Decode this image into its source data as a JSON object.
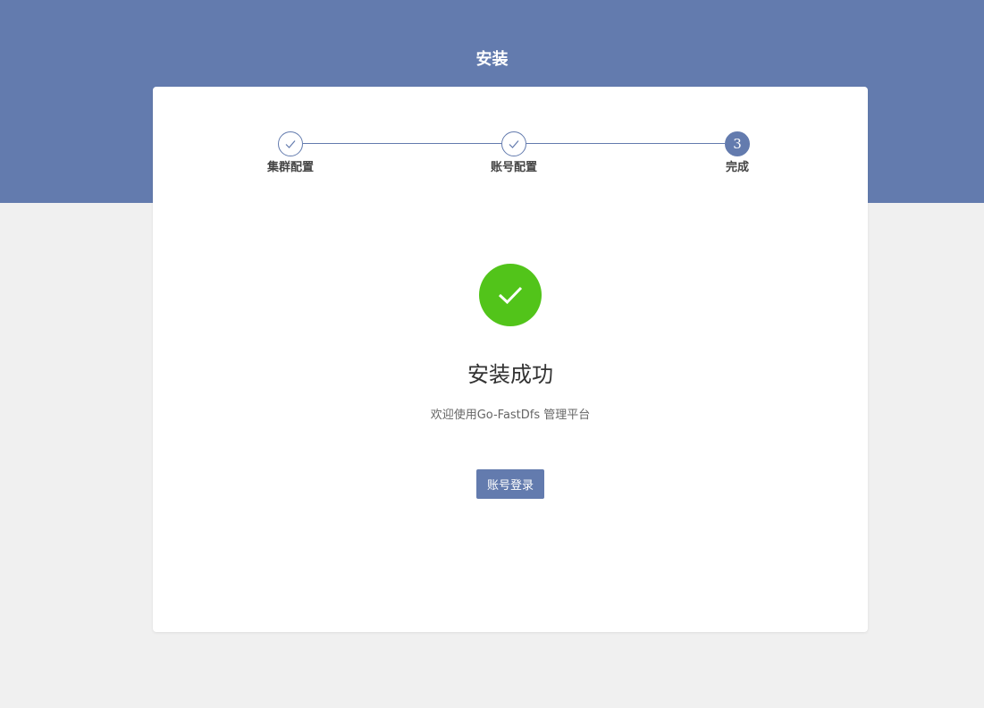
{
  "header": {
    "title": "安装"
  },
  "steps": [
    {
      "label": "集群配置",
      "status": "done",
      "icon": "check-icon"
    },
    {
      "label": "账号配置",
      "status": "done",
      "icon": "check-icon"
    },
    {
      "label": "完成",
      "status": "current",
      "number": "3"
    }
  ],
  "result": {
    "icon": "check-icon",
    "title": "安装成功",
    "subtitle": "欢迎使用Go-FastDfs 管理平台",
    "button_label": "账号登录"
  },
  "colors": {
    "primary": "#637bae",
    "success": "#52c41a",
    "background": "#f0f0f0"
  }
}
